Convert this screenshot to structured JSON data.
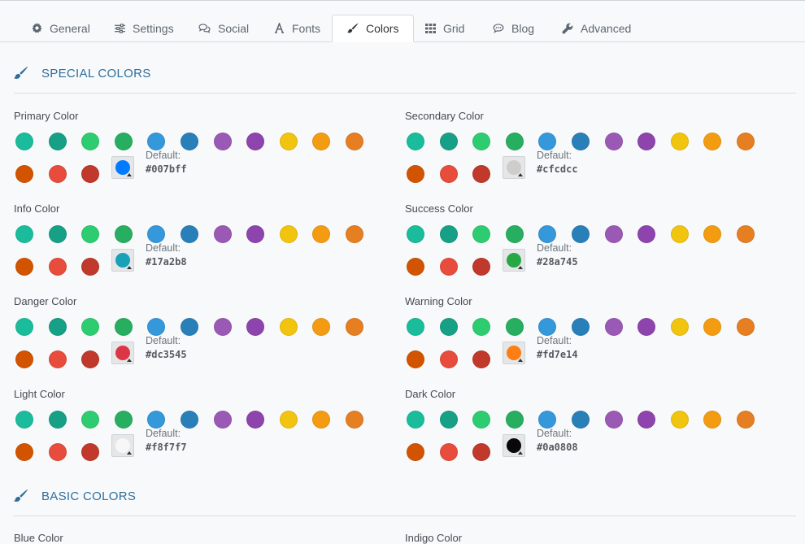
{
  "tabs": [
    {
      "id": "general",
      "label": "General",
      "icon": "gear-icon"
    },
    {
      "id": "settings",
      "label": "Settings",
      "icon": "sliders-icon"
    },
    {
      "id": "social",
      "label": "Social",
      "icon": "comments-icon"
    },
    {
      "id": "fonts",
      "label": "Fonts",
      "icon": "font-icon"
    },
    {
      "id": "colors",
      "label": "Colors",
      "icon": "paint-brush-icon",
      "active": true
    },
    {
      "id": "grid",
      "label": "Grid",
      "icon": "grid-icon"
    },
    {
      "id": "blog",
      "label": "Blog",
      "icon": "speech-bubble-icon"
    },
    {
      "id": "advanced",
      "label": "Advanced",
      "icon": "wrench-icon"
    }
  ],
  "sections": {
    "special": {
      "title": "SPECIAL COLORS",
      "icon": "paint-brush-icon"
    },
    "basic": {
      "title": "BASIC COLORS",
      "icon": "paint-brush-icon"
    }
  },
  "palette": {
    "row1": [
      "#1abc9c",
      "#16a085",
      "#2ecc71",
      "#27ae60",
      "#3498db",
      "#2980b9",
      "#9b59b6",
      "#8e44ad",
      "#f1c40f",
      "#f39c12",
      "#e67e22"
    ],
    "row2": [
      "#d35400",
      "#e74c3c",
      "#c0392b"
    ]
  },
  "default_label": "Default:",
  "fields": [
    {
      "name": "primary",
      "label": "Primary Color",
      "current": "#007bff",
      "default": "#007bff"
    },
    {
      "name": "secondary",
      "label": "Secondary Color",
      "current": "#cfcdcc",
      "default": "#cfcdcc"
    },
    {
      "name": "info",
      "label": "Info Color",
      "current": "#17a2b8",
      "default": "#17a2b8"
    },
    {
      "name": "success",
      "label": "Success Color",
      "current": "#28a745",
      "default": "#28a745"
    },
    {
      "name": "danger",
      "label": "Danger Color",
      "current": "#dc3545",
      "default": "#dc3545"
    },
    {
      "name": "warning",
      "label": "Warning Color",
      "current": "#fd7e14",
      "default": "#fd7e14"
    },
    {
      "name": "light",
      "label": "Light Color",
      "current": "#f8f7f7",
      "default": "#f8f7f7"
    },
    {
      "name": "dark",
      "label": "Dark Color",
      "current": "#0a0808",
      "default": "#0a0808"
    }
  ],
  "basic_fields": [
    {
      "label": "Blue Color"
    },
    {
      "label": "Indigo Color"
    }
  ]
}
